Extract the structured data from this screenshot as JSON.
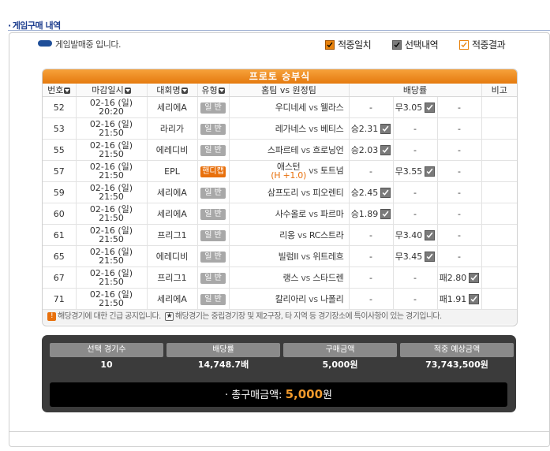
{
  "section_title": "게임구매 내역",
  "status_text": "게임발매중 입니다.",
  "legend": [
    {
      "label": "적중일치"
    },
    {
      "label": "선택내역"
    },
    {
      "label": "적중결과"
    }
  ],
  "table_title": "프로토 승부식",
  "columns": [
    "번호",
    "마감일시",
    "대회명",
    "유형",
    "홈팀 vs 원정팀",
    "배당률",
    "비고"
  ],
  "rows": [
    {
      "no": "52",
      "d1": "02-16 (일)",
      "d2": "20:20",
      "league": "세리에A",
      "type": "일 반",
      "home": "우디네세",
      "away": "웰라스",
      "hcp": "",
      "o1": "-",
      "o1c": false,
      "o2": "무3.05",
      "o2c": true,
      "o3": "-",
      "o3c": false
    },
    {
      "no": "53",
      "d1": "02-16 (일)",
      "d2": "21:50",
      "league": "라리가",
      "type": "일 반",
      "home": "레가네스",
      "away": "베티스",
      "hcp": "",
      "o1": "승2.31",
      "o1c": true,
      "o2": "-",
      "o2c": false,
      "o3": "-",
      "o3c": false
    },
    {
      "no": "55",
      "d1": "02-16 (일)",
      "d2": "21:50",
      "league": "에레디비",
      "type": "일 반",
      "home": "스파르테",
      "away": "흐로닝언",
      "hcp": "",
      "o1": "승2.03",
      "o1c": true,
      "o2": "-",
      "o2c": false,
      "o3": "-",
      "o3c": false
    },
    {
      "no": "57",
      "d1": "02-16 (일)",
      "d2": "21:50",
      "league": "EPL",
      "type": "핸디캡",
      "home": "애스턴",
      "away": "토트넘",
      "hcp": "(H +1.0)",
      "o1": "-",
      "o1c": false,
      "o2": "무3.55",
      "o2c": true,
      "o3": "-",
      "o3c": false
    },
    {
      "no": "59",
      "d1": "02-16 (일)",
      "d2": "21:50",
      "league": "세리에A",
      "type": "일 반",
      "home": "삼프도리",
      "away": "피오렌티",
      "hcp": "",
      "o1": "승2.45",
      "o1c": true,
      "o2": "-",
      "o2c": false,
      "o3": "-",
      "o3c": false
    },
    {
      "no": "60",
      "d1": "02-16 (일)",
      "d2": "21:50",
      "league": "세리에A",
      "type": "일 반",
      "home": "사수올로",
      "away": "파르마",
      "hcp": "",
      "o1": "승1.89",
      "o1c": true,
      "o2": "-",
      "o2c": false,
      "o3": "-",
      "o3c": false
    },
    {
      "no": "61",
      "d1": "02-16 (일)",
      "d2": "21:50",
      "league": "프리그1",
      "type": "일 반",
      "home": "리옹",
      "away": "RC스트라",
      "hcp": "",
      "o1": "-",
      "o1c": false,
      "o2": "무3.40",
      "o2c": true,
      "o3": "-",
      "o3c": false
    },
    {
      "no": "65",
      "d1": "02-16 (일)",
      "d2": "21:50",
      "league": "에레디비",
      "type": "일 반",
      "home": "빌럼II",
      "away": "위트레흐",
      "hcp": "",
      "o1": "-",
      "o1c": false,
      "o2": "무3.45",
      "o2c": true,
      "o3": "-",
      "o3c": false
    },
    {
      "no": "67",
      "d1": "02-16 (일)",
      "d2": "21:50",
      "league": "프리그1",
      "type": "일 반",
      "home": "랭스",
      "away": "스타드렌",
      "hcp": "",
      "o1": "-",
      "o1c": false,
      "o2": "-",
      "o2c": false,
      "o3": "패2.80",
      "o3c": true
    },
    {
      "no": "71",
      "d1": "02-16 (일)",
      "d2": "21:50",
      "league": "세리에A",
      "type": "일 반",
      "home": "칼리아리",
      "away": "나폴리",
      "hcp": "",
      "o1": "-",
      "o1c": false,
      "o2": "-",
      "o2c": false,
      "o3": "패1.91",
      "o3c": true
    }
  ],
  "vs_label": "vs",
  "notice1": "해당경기에 대한 긴급 공지입니다.",
  "notice2": "해당경기는 중립경기장 및 제2구장, 타 지역 등 경기장소에 특이사항이 있는 경기입니다.",
  "notice1_icon": "!",
  "notice2_icon": "★",
  "summary": {
    "labels": [
      "선택 경기수",
      "배당률",
      "구매금액",
      "적중 예상금액"
    ],
    "values": [
      "10",
      "14,748.7배",
      "5,000원",
      "73,743,500원"
    ],
    "total_label": "총구매금액:",
    "total_value": "5,000",
    "total_unit": "원"
  },
  "colors": {
    "accent": "#e8700c",
    "title_blue": "#1f3f8f",
    "summary_bg": "#3b3b3b"
  }
}
